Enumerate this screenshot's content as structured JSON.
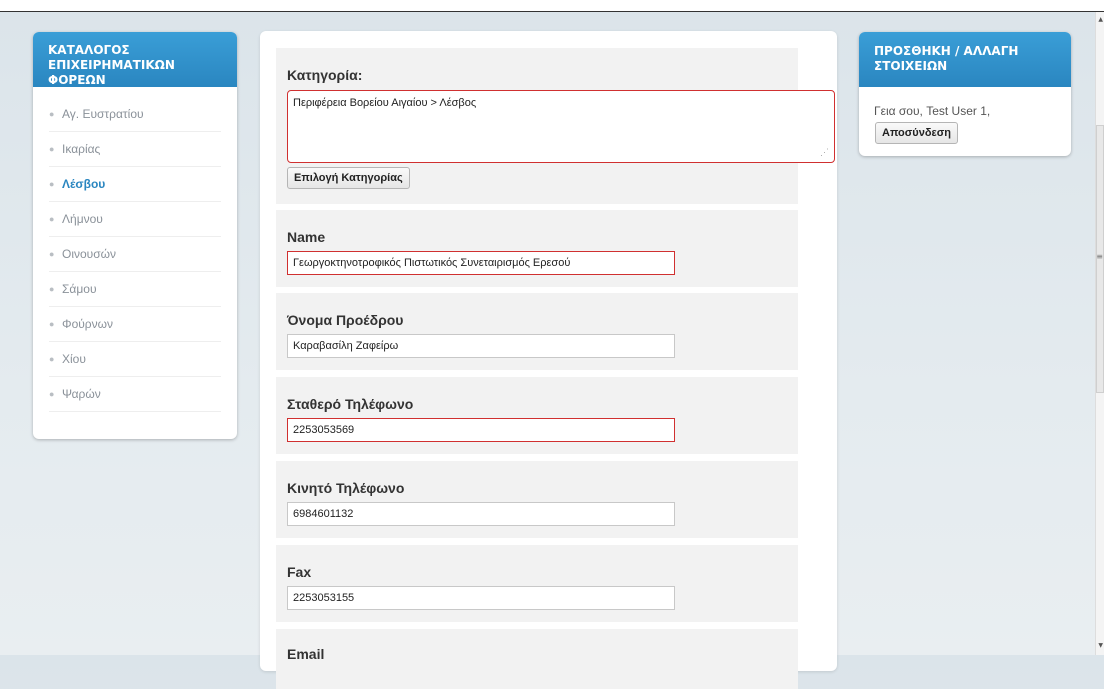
{
  "left_panel": {
    "title": "ΚΑΤΑΛΟΓΟΣ ΕΠΙΧΕΙΡΗΜΑΤΙΚΩΝ ΦΟΡΕΩΝ",
    "items": [
      {
        "label": "Αγ. Ευστρατίου",
        "active": false
      },
      {
        "label": "Ικαρίας",
        "active": false
      },
      {
        "label": "Λέσβου",
        "active": true
      },
      {
        "label": "Λήμνου",
        "active": false
      },
      {
        "label": "Οινουσών",
        "active": false
      },
      {
        "label": "Σάμου",
        "active": false
      },
      {
        "label": "Φούρνων",
        "active": false
      },
      {
        "label": "Χίου",
        "active": false
      },
      {
        "label": "Ψαρών",
        "active": false
      }
    ]
  },
  "form": {
    "category": {
      "label": "Κατηγορία:",
      "value": "Περιφέρεια Βορείου Αιγαίου > Λέσβος",
      "button": "Επιλογή Κατηγορίας"
    },
    "name": {
      "label": "Name",
      "value": "Γεωργοκτηνοτροφικός Πιστωτικός Συνεταιρισμός  Ερεσού"
    },
    "president": {
      "label": "Όνομα Προέδρου",
      "value": "Καραβασίλη Ζαφείρω"
    },
    "landline": {
      "label": "Σταθερό Τηλέφωνο",
      "value": "2253053569"
    },
    "mobile": {
      "label": "Κινητό Τηλέφωνο",
      "value": "6984601132"
    },
    "fax": {
      "label": "Fax",
      "value": "2253053155"
    },
    "email": {
      "label": "Email"
    }
  },
  "right_panel": {
    "title": "ΠΡΟΣΘΗΚΗ / ΑΛΛΑΓΗ ΣΤΟΙΧΕΙΩΝ",
    "greeting": "Γεια σου, Test User 1,",
    "logout": "Αποσύνδεση"
  },
  "colors": {
    "accent": "#2a86c0",
    "error_border": "#d03030"
  }
}
